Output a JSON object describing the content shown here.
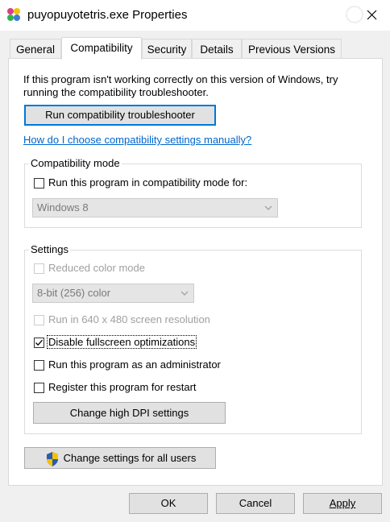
{
  "window": {
    "title": "puyopuyotetris.exe Properties",
    "help_glyph": "?"
  },
  "tabs": [
    {
      "label": "General"
    },
    {
      "label": "Compatibility"
    },
    {
      "label": "Security"
    },
    {
      "label": "Details"
    },
    {
      "label": "Previous Versions"
    }
  ],
  "compat": {
    "intro_line1": "If this program isn't working correctly on this version of Windows, try",
    "intro_line2": "running the compatibility troubleshooter.",
    "troubleshooter_button": "Run compatibility troubleshooter",
    "manual_link": "How do I choose compatibility settings manually?"
  },
  "compat_mode": {
    "group_label": "Compatibility mode",
    "checkbox_label": "Run this program in compatibility mode for:",
    "checked": false,
    "os_select_value": "Windows 8"
  },
  "settings": {
    "group_label": "Settings",
    "reduced_color_label": "Reduced color mode",
    "color_select_value": "8-bit (256) color",
    "res640_label": "Run in 640 x 480 screen resolution",
    "fullscreen_opt_label": "Disable fullscreen optimizations",
    "fullscreen_opt_checked": true,
    "admin_label": "Run this program as an administrator",
    "restart_label": "Register this program for restart",
    "dpi_button": "Change high DPI settings"
  },
  "all_users_button": "Change settings for all users",
  "footer": {
    "ok": "OK",
    "cancel": "Cancel",
    "apply": "Apply"
  },
  "colors": {
    "accent": "#0078d7",
    "link": "#0066cc",
    "disabled_text": "#a0a0a0"
  }
}
